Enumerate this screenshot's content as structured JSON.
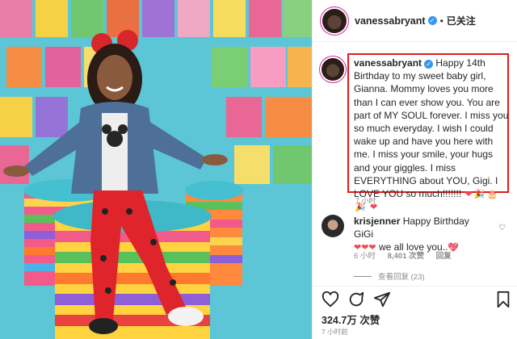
{
  "post": {
    "username": "vanessabryant",
    "follow_label": "已关注",
    "caption_text": "Happy 14th Birthday to my sweet baby girl, Gianna. Mommy loves you more than I can ever show you. You are part of MY SOUL forever. I miss you so much everyday. I wish I could wake up and have you here with me. I miss your smile, your hugs and your giggles. I miss EVERYTHING about YOU, Gigi. I LOVE YOU so much!!!!!!!",
    "caption_emojis": [
      "❤",
      "🎉",
      "🎂",
      "🎉",
      "❤"
    ],
    "caption_time": "7 小时"
  },
  "comment": {
    "username": "krisjenner",
    "text": "Happy Birthday GiGi",
    "line2_text": "we all love you..",
    "emojis": [
      "❤❤❤",
      "💖"
    ],
    "time": "6 小时",
    "likes": "8,401 次赞",
    "reply_label": "回复",
    "view_replies": "查看回复 (23)"
  },
  "footer": {
    "likes": "324.7万 次赞",
    "date": "7 小时前"
  },
  "icons": {
    "heart": "heart-icon",
    "comment": "comment-icon",
    "share": "share-icon",
    "save": "bookmark-icon"
  },
  "colors": {
    "highlight_box": "#e31b1b",
    "verified": "#3897f0",
    "heart_red": "#ed4956"
  }
}
